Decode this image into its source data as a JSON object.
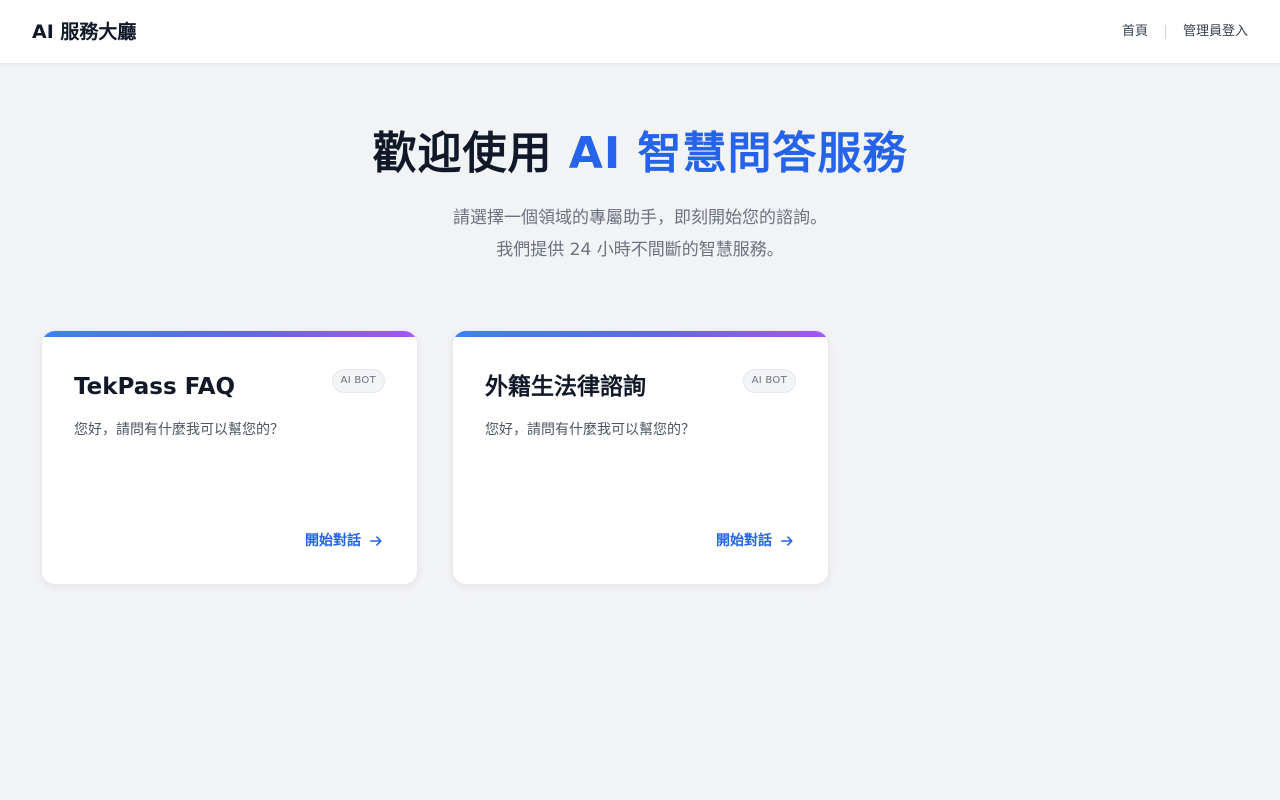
{
  "nav": {
    "brand": "AI 服務大廳",
    "links": [
      "首頁",
      "管理員登入"
    ]
  },
  "hero": {
    "title_main": "歡迎使用 ",
    "title_accent": "AI 智慧問答服務",
    "subtitle_line1": "請選擇一個領域的專屬助手，即刻開始您的諮詢。",
    "subtitle_line2": "我們提供 24 小時不間斷的智慧服務。"
  },
  "cards": [
    {
      "title": "TekPass FAQ",
      "badge": "AI BOT",
      "description": "您好，請問有什麼我可以幫您的？",
      "cta": "開始對話",
      "cta_icon": "arrow-right-icon"
    },
    {
      "title": "外籍生法律諮詢",
      "badge": "AI BOT",
      "description": "您好，請問有什麼我可以幫您的？",
      "cta": "開始對話",
      "cta_icon": "arrow-right-icon"
    }
  ],
  "colors": {
    "accent": "#2563eb",
    "background": "#f2f3f5",
    "gradient_start": "#3b82f6",
    "gradient_end": "#a855f7"
  }
}
